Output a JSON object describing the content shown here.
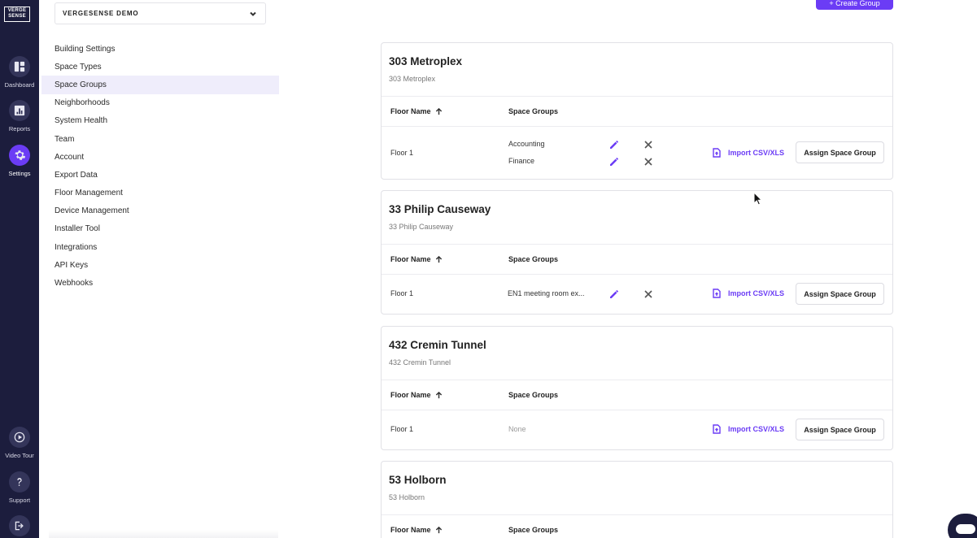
{
  "logo": {
    "line1": "VERGE",
    "line2": "SENSE"
  },
  "rail": {
    "items": [
      {
        "label": "Dashboard",
        "icon": "dashboard-icon"
      },
      {
        "label": "Reports",
        "icon": "reports-icon"
      },
      {
        "label": "Settings",
        "icon": "gear-icon",
        "active": true
      },
      {
        "label": "Video Tour",
        "icon": "play-icon"
      },
      {
        "label": "Support",
        "icon": "question-icon"
      }
    ]
  },
  "org_select": {
    "value": "VERGESENSE DEMO"
  },
  "nav": {
    "items": [
      "Building Settings",
      "Space Types",
      "Space Groups",
      "Neighborhoods",
      "System Health",
      "Team",
      "Account",
      "Export Data",
      "Floor Management",
      "Device Management",
      "Installer Tool",
      "Integrations",
      "API Keys",
      "Webhooks"
    ],
    "active": "Space Groups"
  },
  "main": {
    "create_button": "+ Create Group",
    "col_floor": "Floor Name",
    "col_groups": "Space Groups",
    "import_label": "Import CSV/XLS",
    "assign_label": "Assign Space Group",
    "buildings": [
      {
        "title": "303 Metroplex",
        "subtitle": "303 Metroplex",
        "floor": "Floor 1",
        "groups": [
          "Accounting",
          "Finance"
        ]
      },
      {
        "title": "33 Philip Causeway",
        "subtitle": "33 Philip Causeway",
        "floor": "Floor 1",
        "groups": [
          "EN1 meeting room ex..."
        ]
      },
      {
        "title": "432 Cremin Tunnel",
        "subtitle": "432 Cremin Tunnel",
        "floor": "Floor 1",
        "groups": [],
        "none_label": "None"
      },
      {
        "title": "53 Holborn",
        "subtitle": "53 Holborn"
      }
    ]
  },
  "colors": {
    "rail_bg": "#1c1d3d",
    "accent": "#6b3cf5",
    "active_nav_bg": "#efedfb"
  }
}
